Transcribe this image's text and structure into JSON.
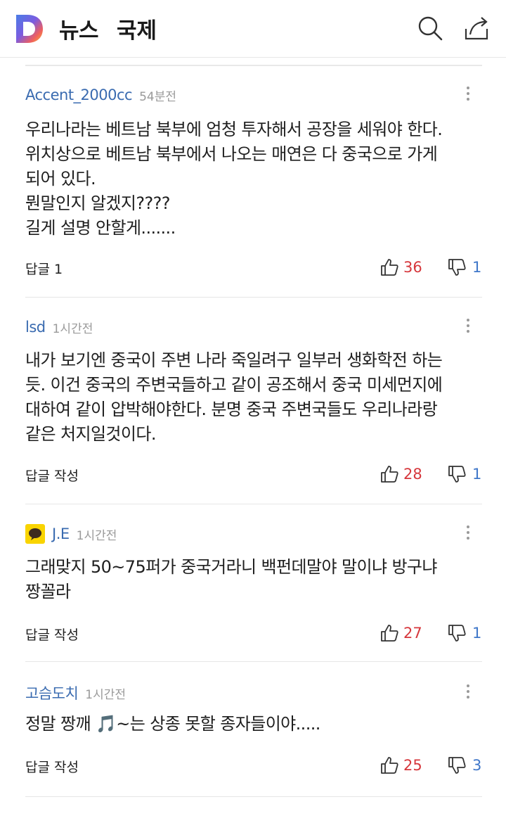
{
  "header": {
    "title": "뉴스",
    "section": "국제",
    "icons": [
      "daum-logo",
      "search-icon",
      "share-icon"
    ]
  },
  "colors": {
    "author": "#3a6bb0",
    "like": "#d6373c",
    "dislike": "#3f77c9",
    "time": "#9a9a9a"
  },
  "comments": [
    {
      "author": "Accent_2000cc",
      "time": "54분전",
      "lines": [
        "우리나라는 베트남 북부에 엄청 투자해서 공장을 세워야 한다.",
        "위치상으로 베트남 북부에서 나오는 매연은 다 중국으로 가게",
        "되어 있다.",
        "뭔말인지 알겠지????",
        "길게 설명 안할게......."
      ],
      "reply": "답글 1",
      "likes": "36",
      "dislikes": "1"
    },
    {
      "author": "lsd",
      "time": "1시간전",
      "lines": [
        "내가 보기엔 중국이 주변 나라 죽일려구 일부러 생화학전 하는",
        "듯. 이건 중국의 주변국들하고 같이 공조해서 중국 미세먼지에",
        "대하여 같이 압박해야한다. 분명 중국 주변국들도 우리나라랑",
        "같은 처지일것이다."
      ],
      "reply": "답글 작성",
      "likes": "28",
      "dislikes": "1"
    },
    {
      "author": "J.E",
      "time": "1시간전",
      "lines": [
        "그래맞지 50~75퍼가 중국거라니 백펀데말야  말이냐 방구냐",
        "짱꼴라"
      ],
      "reply": "답글 작성",
      "likes": "27",
      "dislikes": "1"
    },
    {
      "author": "고슴도치",
      "time": "1시간전",
      "lines": [
        "정말 짱깨 🎵~는 상종 못할 종자들이야....."
      ],
      "reply": "답글 작성",
      "likes": "25",
      "dislikes": "3"
    }
  ]
}
